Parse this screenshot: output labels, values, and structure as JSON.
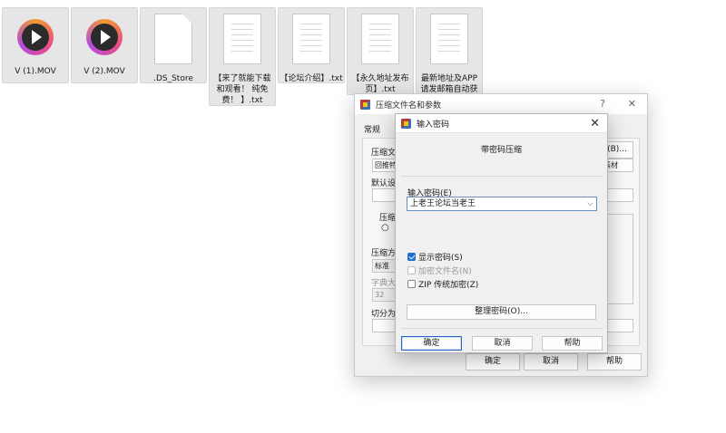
{
  "files": [
    {
      "name": "V (1).MOV",
      "type": "video"
    },
    {
      "name": "V (2).MOV",
      "type": "video"
    },
    {
      "name": ".DS_Store",
      "type": "blank"
    },
    {
      "name": "【来了就能下载和观看！ 纯免费！ 】.txt",
      "type": "text"
    },
    {
      "name": "【论坛介绍】.txt",
      "type": "text"
    },
    {
      "name": "【永久地址发布页】.txt",
      "type": "text"
    },
    {
      "name": "最新地址及APP请发邮箱自动获",
      "type": "text"
    }
  ],
  "bg_dialog": {
    "title": "压缩文件名和参数",
    "help_glyph": "?",
    "close_glyph": "✕",
    "tab": "常规",
    "lbl_archive_name": "压缩文",
    "archive_name_value": "回推特",
    "browse_btn": "(B)...",
    "lbl_default": "默认设",
    "format_value": "素材",
    "lbl_format": "压缩",
    "lbl_method": "压缩方",
    "method_value": "标准",
    "lbl_dict": "字典大",
    "dict_value": "32",
    "lbl_split": "切分为",
    "ok_btn": "确定",
    "cancel_btn": "取消",
    "help_btn": "帮助"
  },
  "pwd_dialog": {
    "title": "输入密码",
    "close_glyph": "✕",
    "heading": "带密码压缩",
    "password_label": "输入密码(E)",
    "password_value": "上老王论坛当老王",
    "show_password": {
      "label": "显示密码(S)",
      "checked": true,
      "enabled": true
    },
    "encrypt_names": {
      "label": "加密文件名(N)",
      "checked": false,
      "enabled": false
    },
    "zip_legacy": {
      "label": "ZIP 传统加密(Z)",
      "checked": false,
      "enabled": true
    },
    "organize_btn": "整理密码(O)...",
    "ok_btn": "确定",
    "cancel_btn": "取消",
    "help_btn": "帮助"
  }
}
